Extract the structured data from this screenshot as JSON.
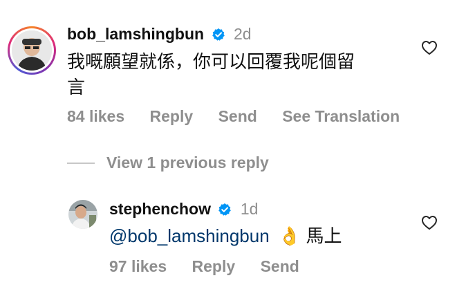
{
  "comments": [
    {
      "username": "bob_lamshingbun",
      "time": "2d",
      "text_line1": "我嘅願望就係，你可以回覆我呢個留",
      "text_line2": "言",
      "likes": "84 likes",
      "reply": "Reply",
      "send": "Send",
      "translate": "See Translation"
    }
  ],
  "view_replies": "View 1 previous reply",
  "reply": {
    "username": "stephenchow",
    "time": "1d",
    "mention": "@bob_lamshingbun",
    "emoji": "👌",
    "text": "馬上",
    "likes": "97 likes",
    "reply_label": "Reply",
    "send": "Send"
  },
  "colors": {
    "secondary": "#8e8e8e",
    "mention": "#00376b",
    "verified": "#0095f6"
  }
}
